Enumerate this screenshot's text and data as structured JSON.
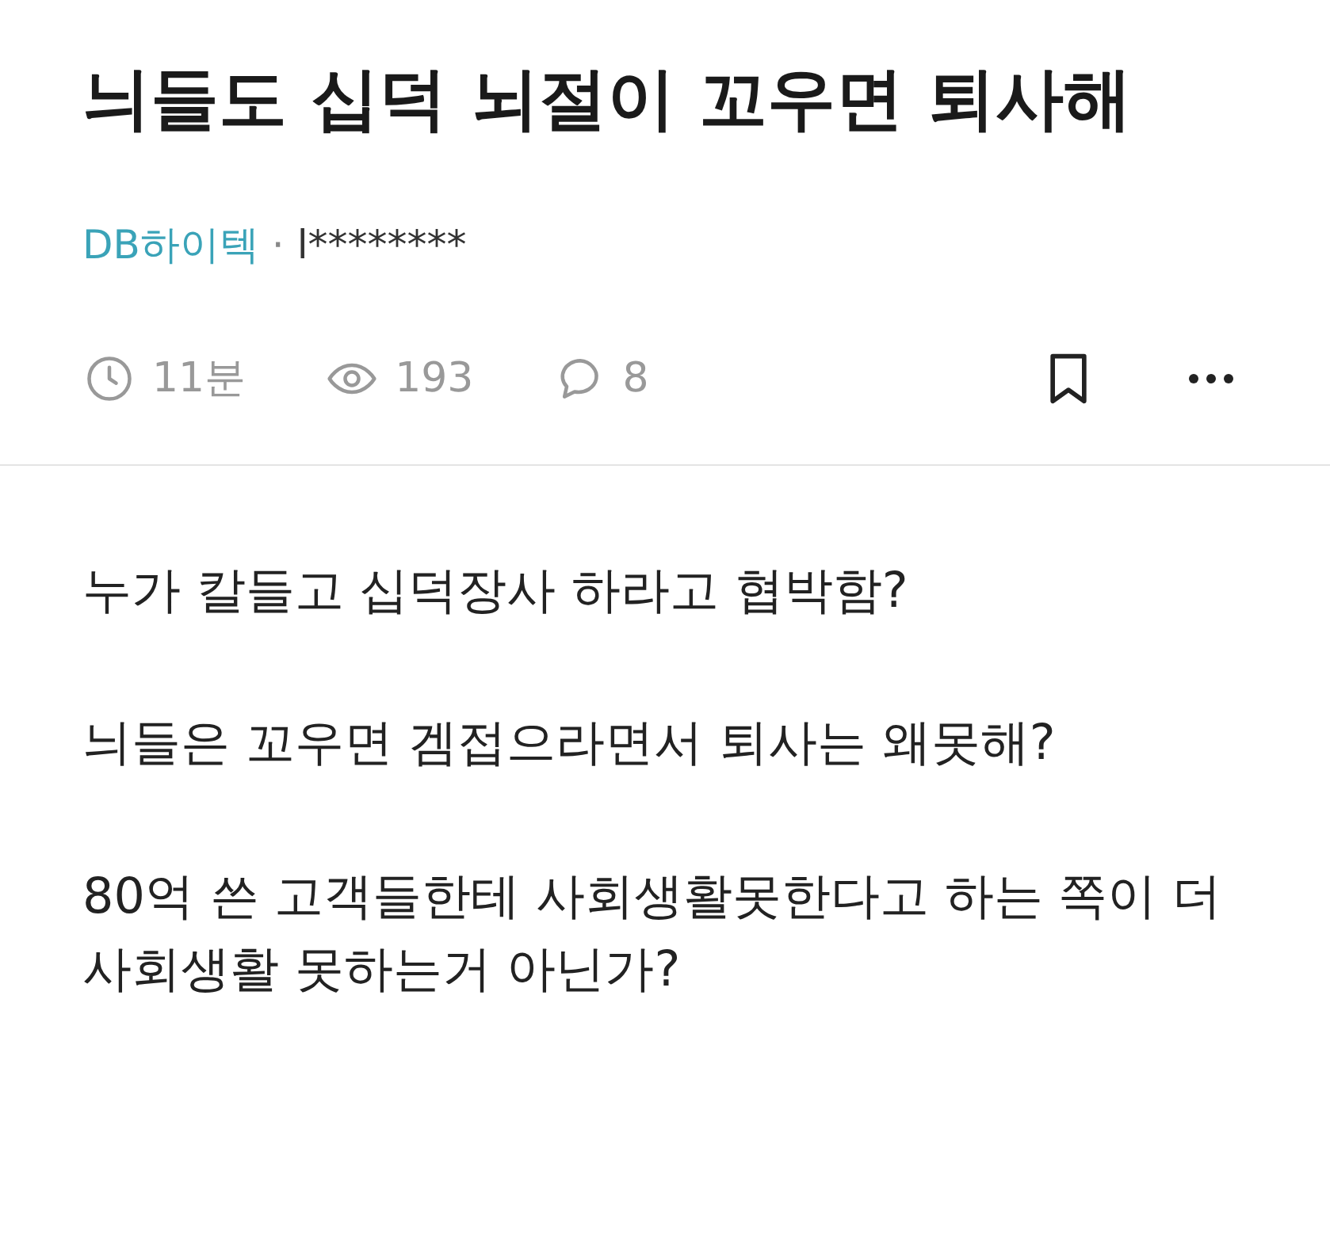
{
  "title": "늬들도 십덕 뇌절이 꼬우면 퇴사해",
  "author": {
    "company": "DB하이텍",
    "separator": "·",
    "name": "l********"
  },
  "stats": [
    {
      "kind": "time",
      "text": "11분"
    },
    {
      "kind": "views",
      "text": "193"
    },
    {
      "kind": "comments",
      "text": "8"
    }
  ],
  "paragraphs": [
    "누가 칼들고 십덕장사 하라고 협박함?",
    "늬들은 꼬우면 겜접으라면서 퇴사는 왜못해?",
    "80억 쓴 고객들한테 사회생활못한다고 하는 쪽이 더 사회생활 못하는거 아닌가?"
  ]
}
